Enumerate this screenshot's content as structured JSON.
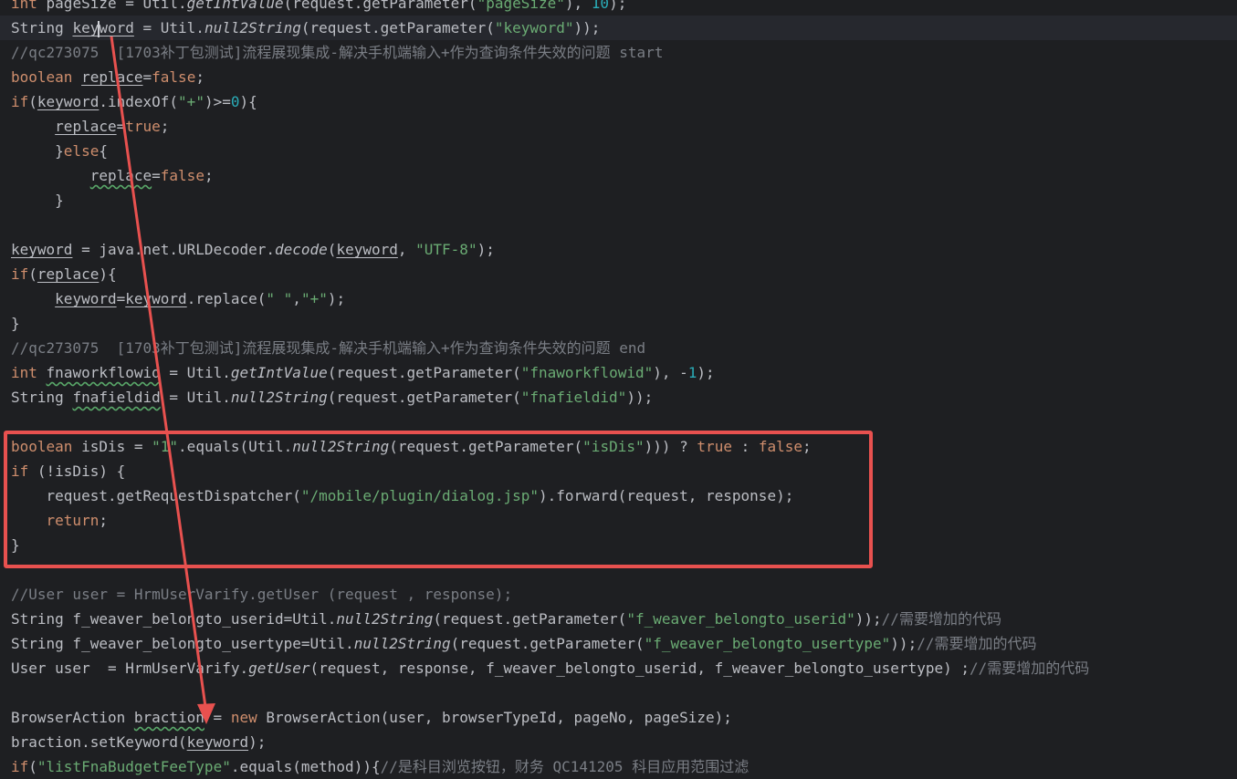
{
  "editor": {
    "lines": [
      {
        "current": false,
        "tokens": [
          [
            "kw",
            "int"
          ],
          [
            "t",
            " pageSize = Util."
          ],
          [
            "it",
            "getIntValue"
          ],
          [
            "t",
            "(request.getParameter("
          ],
          [
            "str",
            "\"pageSize\""
          ],
          [
            "t",
            "), "
          ],
          [
            "num",
            "10"
          ],
          [
            "t",
            ");"
          ]
        ]
      },
      {
        "current": true,
        "tokens": [
          [
            "t",
            "String "
          ],
          [
            "ul",
            "key"
          ],
          [
            "caret",
            ""
          ],
          [
            "ul",
            "word"
          ],
          [
            "t",
            " = Util."
          ],
          [
            "it",
            "null2String"
          ],
          [
            "t",
            "(request.getParameter("
          ],
          [
            "str",
            "\"keyword\""
          ],
          [
            "t",
            "));"
          ]
        ]
      },
      {
        "current": false,
        "tokens": [
          [
            "cmt",
            "//qc273075  [1703补丁包测试]流程展现集成-解决手机端输入+作为查询条件失效的问题 start"
          ]
        ]
      },
      {
        "current": false,
        "tokens": [
          [
            "kw",
            "boolean"
          ],
          [
            "t",
            " "
          ],
          [
            "ul",
            "replace"
          ],
          [
            "t",
            "="
          ],
          [
            "kw",
            "false"
          ],
          [
            "t",
            ";"
          ]
        ]
      },
      {
        "current": false,
        "tokens": [
          [
            "kw",
            "if"
          ],
          [
            "t",
            "("
          ],
          [
            "ul",
            "keyword"
          ],
          [
            "t",
            ".indexOf("
          ],
          [
            "str",
            "\"+\""
          ],
          [
            "t",
            ")>="
          ],
          [
            "num",
            "0"
          ],
          [
            "t",
            "){"
          ]
        ]
      },
      {
        "current": false,
        "tokens": [
          [
            "t",
            "     "
          ],
          [
            "ul",
            "replace"
          ],
          [
            "t",
            "="
          ],
          [
            "kw",
            "true"
          ],
          [
            "t",
            ";"
          ]
        ]
      },
      {
        "current": false,
        "tokens": [
          [
            "t",
            "     }"
          ],
          [
            "kw",
            "else"
          ],
          [
            "t",
            "{"
          ]
        ]
      },
      {
        "current": false,
        "tokens": [
          [
            "t",
            "         "
          ],
          [
            "wavy",
            "replace"
          ],
          [
            "t",
            "="
          ],
          [
            "kw",
            "false"
          ],
          [
            "t",
            ";"
          ]
        ]
      },
      {
        "current": false,
        "tokens": [
          [
            "t",
            "     }"
          ]
        ]
      },
      {
        "current": false,
        "tokens": []
      },
      {
        "current": false,
        "tokens": [
          [
            "ul",
            "keyword"
          ],
          [
            "t",
            " = java.net.URLDecoder."
          ],
          [
            "it",
            "decode"
          ],
          [
            "t",
            "("
          ],
          [
            "ul",
            "keyword"
          ],
          [
            "t",
            ", "
          ],
          [
            "str",
            "\"UTF-8\""
          ],
          [
            "t",
            ");"
          ]
        ]
      },
      {
        "current": false,
        "tokens": [
          [
            "kw",
            "if"
          ],
          [
            "t",
            "("
          ],
          [
            "ul",
            "replace"
          ],
          [
            "t",
            "){"
          ]
        ]
      },
      {
        "current": false,
        "tokens": [
          [
            "t",
            "     "
          ],
          [
            "ul",
            "keyword"
          ],
          [
            "t",
            "="
          ],
          [
            "ul",
            "keyword"
          ],
          [
            "t",
            ".replace("
          ],
          [
            "str",
            "\" \""
          ],
          [
            "t",
            ","
          ],
          [
            "str",
            "\"+\""
          ],
          [
            "t",
            ");"
          ]
        ]
      },
      {
        "current": false,
        "tokens": [
          [
            "t",
            "}"
          ]
        ]
      },
      {
        "current": false,
        "tokens": [
          [
            "cmt",
            "//qc273075  [1703补丁包测试]流程展现集成-解决手机端输入+作为查询条件失效的问题 end"
          ]
        ]
      },
      {
        "current": false,
        "tokens": [
          [
            "kw",
            "int"
          ],
          [
            "t",
            " "
          ],
          [
            "wavy",
            "fnaworkflowid"
          ],
          [
            "t",
            " = Util."
          ],
          [
            "it",
            "getIntValue"
          ],
          [
            "t",
            "(request.getParameter("
          ],
          [
            "str",
            "\"fnaworkflowid\""
          ],
          [
            "t",
            "), -"
          ],
          [
            "num",
            "1"
          ],
          [
            "t",
            ");"
          ]
        ]
      },
      {
        "current": false,
        "tokens": [
          [
            "t",
            "String "
          ],
          [
            "wavy",
            "fnafieldid"
          ],
          [
            "t",
            " = Util."
          ],
          [
            "it",
            "null2String"
          ],
          [
            "t",
            "(request.getParameter("
          ],
          [
            "str",
            "\"fnafieldid\""
          ],
          [
            "t",
            "));"
          ]
        ]
      },
      {
        "current": false,
        "tokens": []
      },
      {
        "current": false,
        "tokens": [
          [
            "kw",
            "boolean"
          ],
          [
            "t",
            " isDis = "
          ],
          [
            "str",
            "\"1\""
          ],
          [
            "t",
            ".equals(Util."
          ],
          [
            "it",
            "null2String"
          ],
          [
            "t",
            "(request.getParameter("
          ],
          [
            "str",
            "\"isDis\""
          ],
          [
            "t",
            ")))"
          ],
          [
            "t",
            " ? "
          ],
          [
            "kw",
            "true"
          ],
          [
            "t",
            " : "
          ],
          [
            "kw",
            "false"
          ],
          [
            "t",
            ";"
          ]
        ]
      },
      {
        "current": false,
        "tokens": [
          [
            "kw",
            "if"
          ],
          [
            "t",
            " (!isDis) {"
          ]
        ]
      },
      {
        "current": false,
        "tokens": [
          [
            "t",
            "    request.getRequestDispatcher("
          ],
          [
            "str",
            "\"/mobile/plugin/dialog.jsp\""
          ],
          [
            "t",
            ").forward(request, response);"
          ]
        ]
      },
      {
        "current": false,
        "tokens": [
          [
            "t",
            "    "
          ],
          [
            "kw",
            "return"
          ],
          [
            "t",
            ";"
          ]
        ]
      },
      {
        "current": false,
        "tokens": [
          [
            "t",
            "}"
          ]
        ]
      },
      {
        "current": false,
        "tokens": []
      },
      {
        "current": false,
        "tokens": [
          [
            "cmt",
            "//User user = HrmUserVarify.getUser (request , response);"
          ]
        ]
      },
      {
        "current": false,
        "tokens": [
          [
            "t",
            "String f_weaver_belongto_userid=Util."
          ],
          [
            "it",
            "null2String"
          ],
          [
            "t",
            "(request.getParameter("
          ],
          [
            "str",
            "\"f_weaver_belongto_userid\""
          ],
          [
            "t",
            "));"
          ],
          [
            "cmt",
            "//需要增加的代码"
          ]
        ]
      },
      {
        "current": false,
        "tokens": [
          [
            "t",
            "String f_weaver_belongto_usertype=Util."
          ],
          [
            "it",
            "null2String"
          ],
          [
            "t",
            "(request.getParameter("
          ],
          [
            "str",
            "\"f_weaver_belongto_usertype\""
          ],
          [
            "t",
            "));"
          ],
          [
            "cmt",
            "//需要增加的代码"
          ]
        ]
      },
      {
        "current": false,
        "tokens": [
          [
            "t",
            "User user  = HrmUserVarify."
          ],
          [
            "it",
            "getUser"
          ],
          [
            "t",
            "(request, response, f_weaver_belongto_userid, f_weaver_belongto_usertype) ;"
          ],
          [
            "cmt",
            "//需要增加的代码"
          ]
        ]
      },
      {
        "current": false,
        "tokens": []
      },
      {
        "current": false,
        "tokens": [
          [
            "t",
            "BrowserAction "
          ],
          [
            "wavy",
            "braction"
          ],
          [
            "t",
            " = "
          ],
          [
            "kw",
            "new"
          ],
          [
            "t",
            " BrowserAction(user, browserTypeId, pageNo, pageSize);"
          ]
        ]
      },
      {
        "current": false,
        "tokens": [
          [
            "t",
            "braction.setKeyword("
          ],
          [
            "ul",
            "keyword"
          ],
          [
            "t",
            ");"
          ]
        ]
      },
      {
        "current": false,
        "tokens": [
          [
            "kw",
            "if"
          ],
          [
            "t",
            "("
          ],
          [
            "str",
            "\"listFnaBudgetFeeType\""
          ],
          [
            "t",
            ".equals(method)){"
          ],
          [
            "cmt",
            "//是科目浏览按钮，财务 QC141205 科目应用范围过滤"
          ]
        ]
      }
    ]
  },
  "annotation": {
    "color": "#e8514f",
    "arrow_from_line": "keyword declaration",
    "arrow_to_line": "BrowserAction braction"
  }
}
